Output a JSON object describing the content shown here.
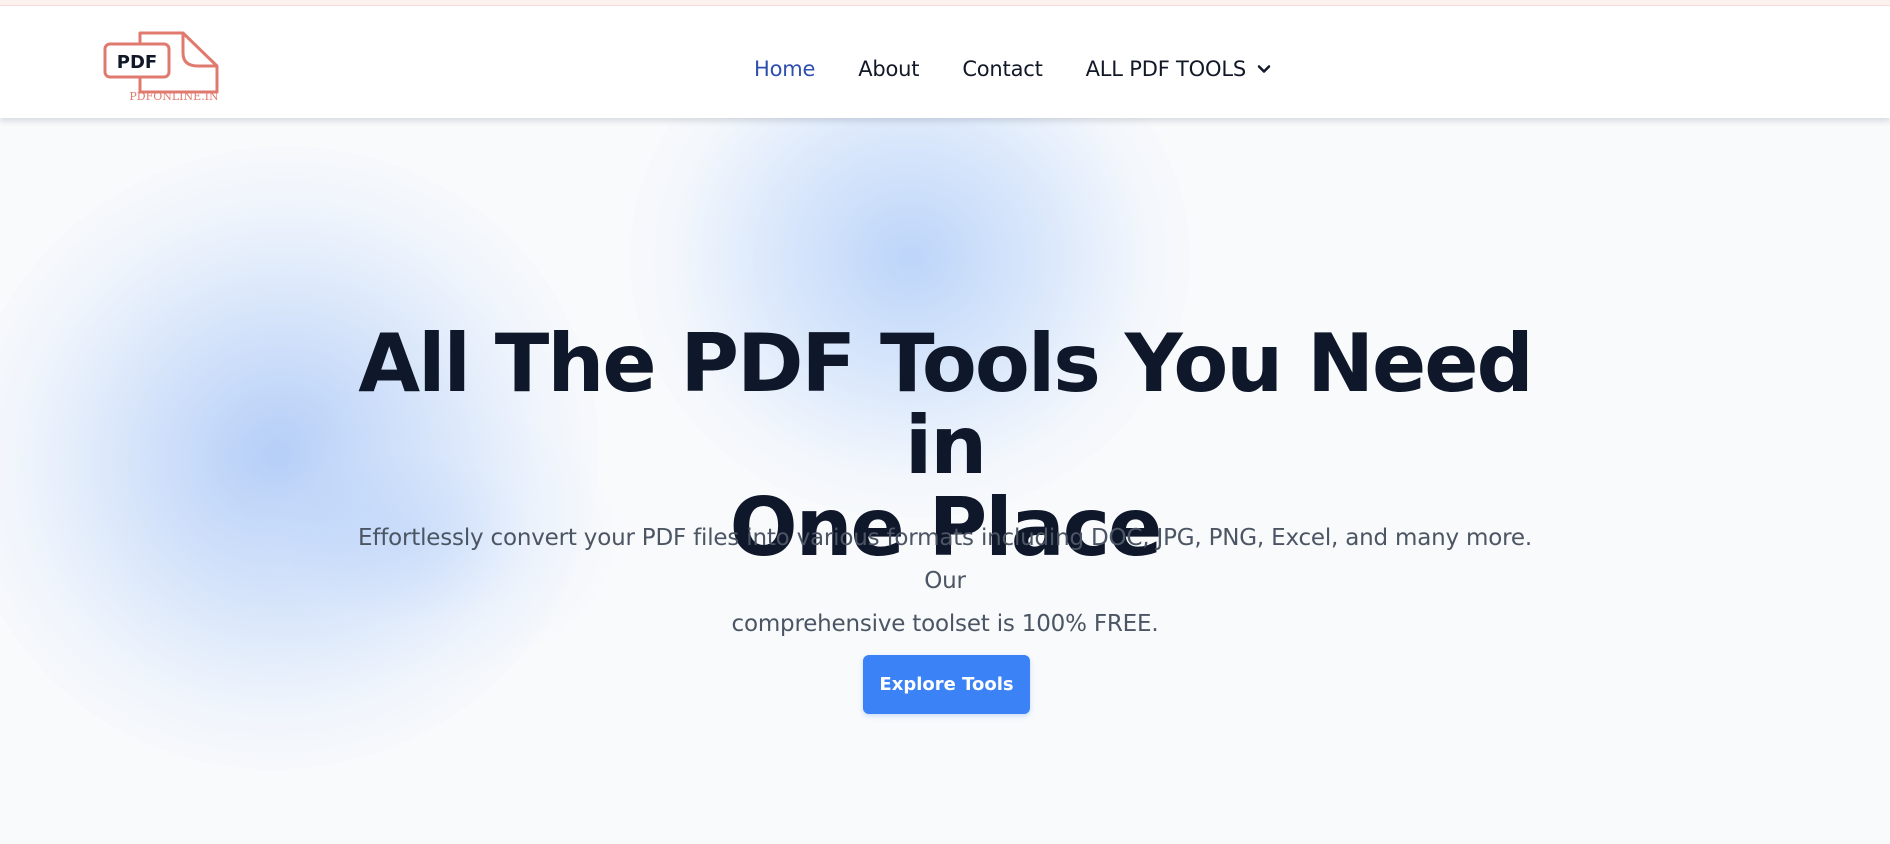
{
  "logo": {
    "badge_text": "PDF",
    "domain_text": "PDFONLINE.IN",
    "colors": {
      "stroke": "#e07a6f",
      "badge_text": "#111827"
    }
  },
  "nav": {
    "items": [
      {
        "label": "Home",
        "active": true
      },
      {
        "label": "About"
      },
      {
        "label": "Contact"
      },
      {
        "label": "ALL PDF TOOLS",
        "icon": "chevron-down-icon"
      }
    ]
  },
  "hero": {
    "title_line1": "All The PDF Tools You Need in",
    "title_line2": "One Place",
    "subtitle_line1": "Effortlessly convert your PDF files into various formats including DOC, JPG, PNG, Excel, and many more. Our",
    "subtitle_line2": "comprehensive toolset is 100% FREE.",
    "button_label": "Explore Tools"
  },
  "colors": {
    "accent": "#3b82f6",
    "active_nav": "#2f4fae",
    "title": "#0f172a",
    "subtitle": "#4b5563",
    "background": "#f8fafc"
  }
}
